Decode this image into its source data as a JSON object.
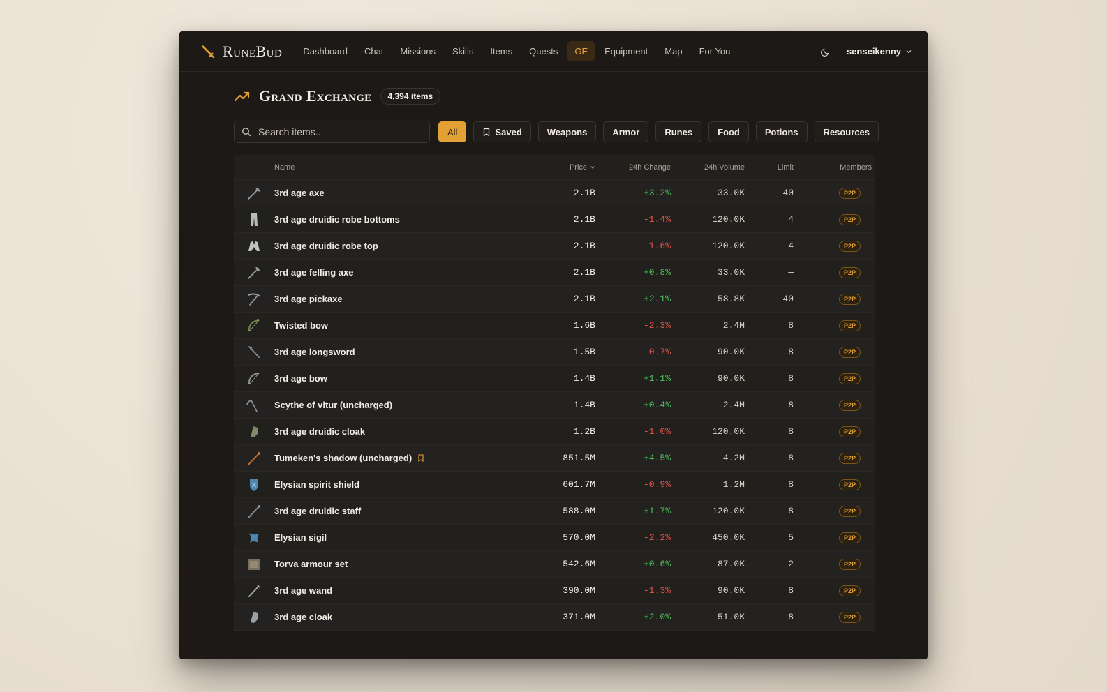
{
  "brand": {
    "name": "RuneBud",
    "accent": "#e3a035"
  },
  "nav": {
    "items": [
      {
        "label": "Dashboard",
        "active": false
      },
      {
        "label": "Chat",
        "active": false
      },
      {
        "label": "Missions",
        "active": false
      },
      {
        "label": "Skills",
        "active": false
      },
      {
        "label": "Items",
        "active": false
      },
      {
        "label": "Quests",
        "active": false
      },
      {
        "label": "GE",
        "active": true
      },
      {
        "label": "Equipment",
        "active": false
      },
      {
        "label": "Map",
        "active": false
      },
      {
        "label": "For You",
        "active": false
      }
    ],
    "theme_icon": "moon-icon",
    "username": "senseikenny"
  },
  "page": {
    "title": "Grand Exchange",
    "count": "4,394 items"
  },
  "search": {
    "placeholder": "Search items...",
    "value": ""
  },
  "filters": [
    {
      "label": "All",
      "active": true
    },
    {
      "label": "Saved",
      "active": false,
      "icon": "bookmark-icon"
    },
    {
      "label": "Weapons",
      "active": false
    },
    {
      "label": "Armor",
      "active": false
    },
    {
      "label": "Runes",
      "active": false
    },
    {
      "label": "Food",
      "active": false
    },
    {
      "label": "Potions",
      "active": false
    },
    {
      "label": "Resources",
      "active": false
    }
  ],
  "table": {
    "headers": {
      "name": "Name",
      "price": "Price",
      "change": "24h Change",
      "volume": "24h Volume",
      "limit": "Limit",
      "members": "Members"
    },
    "rows": [
      {
        "name": "3rd age axe",
        "price": "2.1B",
        "change": "+3.2%",
        "volume": "33.0K",
        "limit": "40",
        "members": "P2P",
        "icon": "axe-icon",
        "color": "#9aa0a6"
      },
      {
        "name": "3rd age druidic robe bottoms",
        "price": "2.1B",
        "change": "-1.4%",
        "volume": "120.0K",
        "limit": "4",
        "members": "P2P",
        "icon": "robe-bottoms-icon",
        "color": "#b8bdb6"
      },
      {
        "name": "3rd age druidic robe top",
        "price": "2.1B",
        "change": "-1.6%",
        "volume": "120.0K",
        "limit": "4",
        "members": "P2P",
        "icon": "robe-top-icon",
        "color": "#c0c4bc"
      },
      {
        "name": "3rd age felling axe",
        "price": "2.1B",
        "change": "+0.8%",
        "volume": "33.0K",
        "limit": "—",
        "members": "P2P",
        "icon": "felling-axe-icon",
        "color": "#9aa0a6"
      },
      {
        "name": "3rd age pickaxe",
        "price": "2.1B",
        "change": "+2.1%",
        "volume": "58.8K",
        "limit": "40",
        "members": "P2P",
        "icon": "pickaxe-icon",
        "color": "#9aa0a6"
      },
      {
        "name": "Twisted bow",
        "price": "1.6B",
        "change": "-2.3%",
        "volume": "2.4M",
        "limit": "8",
        "members": "P2P",
        "icon": "bow-icon",
        "color": "#6f8a3a"
      },
      {
        "name": "3rd age longsword",
        "price": "1.5B",
        "change": "-0.7%",
        "volume": "90.0K",
        "limit": "8",
        "members": "P2P",
        "icon": "sword-icon",
        "color": "#8c9096"
      },
      {
        "name": "3rd age bow",
        "price": "1.4B",
        "change": "+1.1%",
        "volume": "90.0K",
        "limit": "8",
        "members": "P2P",
        "icon": "bow-icon",
        "color": "#8c9096"
      },
      {
        "name": "Scythe of vitur (uncharged)",
        "price": "1.4B",
        "change": "+0.4%",
        "volume": "2.4M",
        "limit": "8",
        "members": "P2P",
        "icon": "scythe-icon",
        "color": "#8c9096"
      },
      {
        "name": "3rd age druidic cloak",
        "price": "1.2B",
        "change": "-1.0%",
        "volume": "120.0K",
        "limit": "8",
        "members": "P2P",
        "icon": "cloak-icon",
        "color": "#7f8a6a"
      },
      {
        "name": "Tumeken's shadow (uncharged)",
        "price": "851.5M",
        "change": "+4.5%",
        "volume": "4.2M",
        "limit": "8",
        "members": "P2P",
        "icon": "staff-icon",
        "color": "#c9702a",
        "saved": true
      },
      {
        "name": "Elysian spirit shield",
        "price": "601.7M",
        "change": "-0.9%",
        "volume": "1.2M",
        "limit": "8",
        "members": "P2P",
        "icon": "shield-icon",
        "color": "#4f86b0"
      },
      {
        "name": "3rd age druidic staff",
        "price": "588.0M",
        "change": "+1.7%",
        "volume": "120.0K",
        "limit": "8",
        "members": "P2P",
        "icon": "staff-icon",
        "color": "#8c9096"
      },
      {
        "name": "Elysian sigil",
        "price": "570.0M",
        "change": "-2.2%",
        "volume": "450.0K",
        "limit": "5",
        "members": "P2P",
        "icon": "sigil-icon",
        "color": "#4f86b0"
      },
      {
        "name": "Torva armour set",
        "price": "542.6M",
        "change": "+0.6%",
        "volume": "87.0K",
        "limit": "2",
        "members": "P2P",
        "icon": "armour-set-icon",
        "color": "#7a6e5c"
      },
      {
        "name": "3rd age wand",
        "price": "390.0M",
        "change": "-1.3%",
        "volume": "90.0K",
        "limit": "8",
        "members": "P2P",
        "icon": "wand-icon",
        "color": "#a5a9ad"
      },
      {
        "name": "3rd age cloak",
        "price": "371.0M",
        "change": "+2.0%",
        "volume": "51.0K",
        "limit": "8",
        "members": "P2P",
        "icon": "cloak-icon",
        "color": "#9aa0a6"
      }
    ]
  }
}
